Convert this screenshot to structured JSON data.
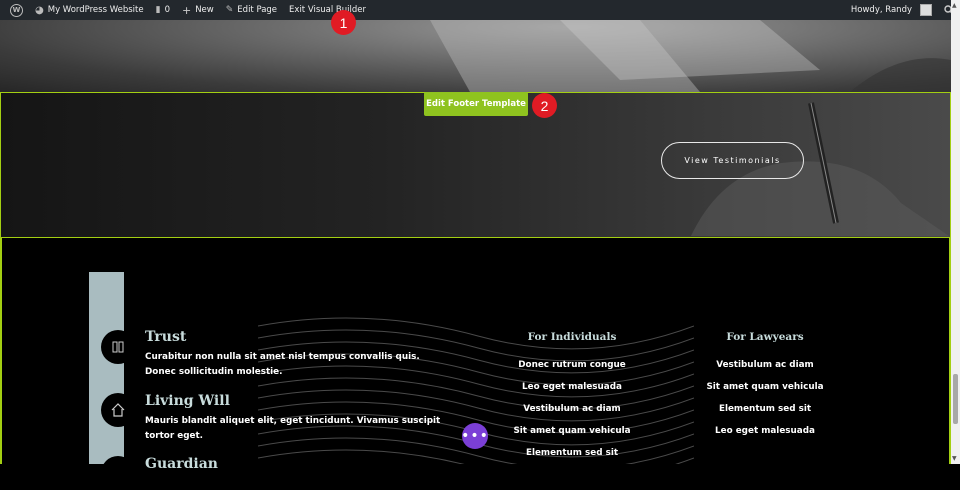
{
  "adminbar": {
    "site_name": "My WordPress Website",
    "comments_count": "0",
    "new_label": "New",
    "edit_page": "Edit Page",
    "exit_builder": "Exit Visual Builder",
    "howdy": "Howdy, Randy"
  },
  "builder": {
    "edit_footer_label": "Edit Footer Template",
    "testimonials_label": "View Testimonials"
  },
  "badges": [
    "1",
    "2"
  ],
  "footer": {
    "sections": [
      {
        "title": "Trust",
        "text": "Curabitur non nulla sit amet nisl tempus convallis quis. Donec sollicitudin molestie."
      },
      {
        "title": "Living Will",
        "text": "Mauris blandit aliquet elit, eget tincidunt. Vivamus suscipit tortor eget."
      },
      {
        "title": "Guardian",
        "text": ""
      }
    ],
    "columns": [
      {
        "title": "For Individuals",
        "items": [
          "Donec rutrum congue",
          "Leo eget malesuada",
          "Vestibulum ac diam",
          "Sit amet quam vehicula",
          "Elementum sed sit"
        ]
      },
      {
        "title": "For Lawyears",
        "items": [
          "Vestibulum ac diam",
          "Sit amet quam vehicula",
          "Elementum sed sit",
          "Leo eget malesuada"
        ]
      }
    ]
  },
  "colors": {
    "accent_green": "#8fc31f",
    "badge_red": "#e01b24",
    "dots_purple": "#7b3fd6",
    "heading_teal": "#c8dcdc"
  }
}
